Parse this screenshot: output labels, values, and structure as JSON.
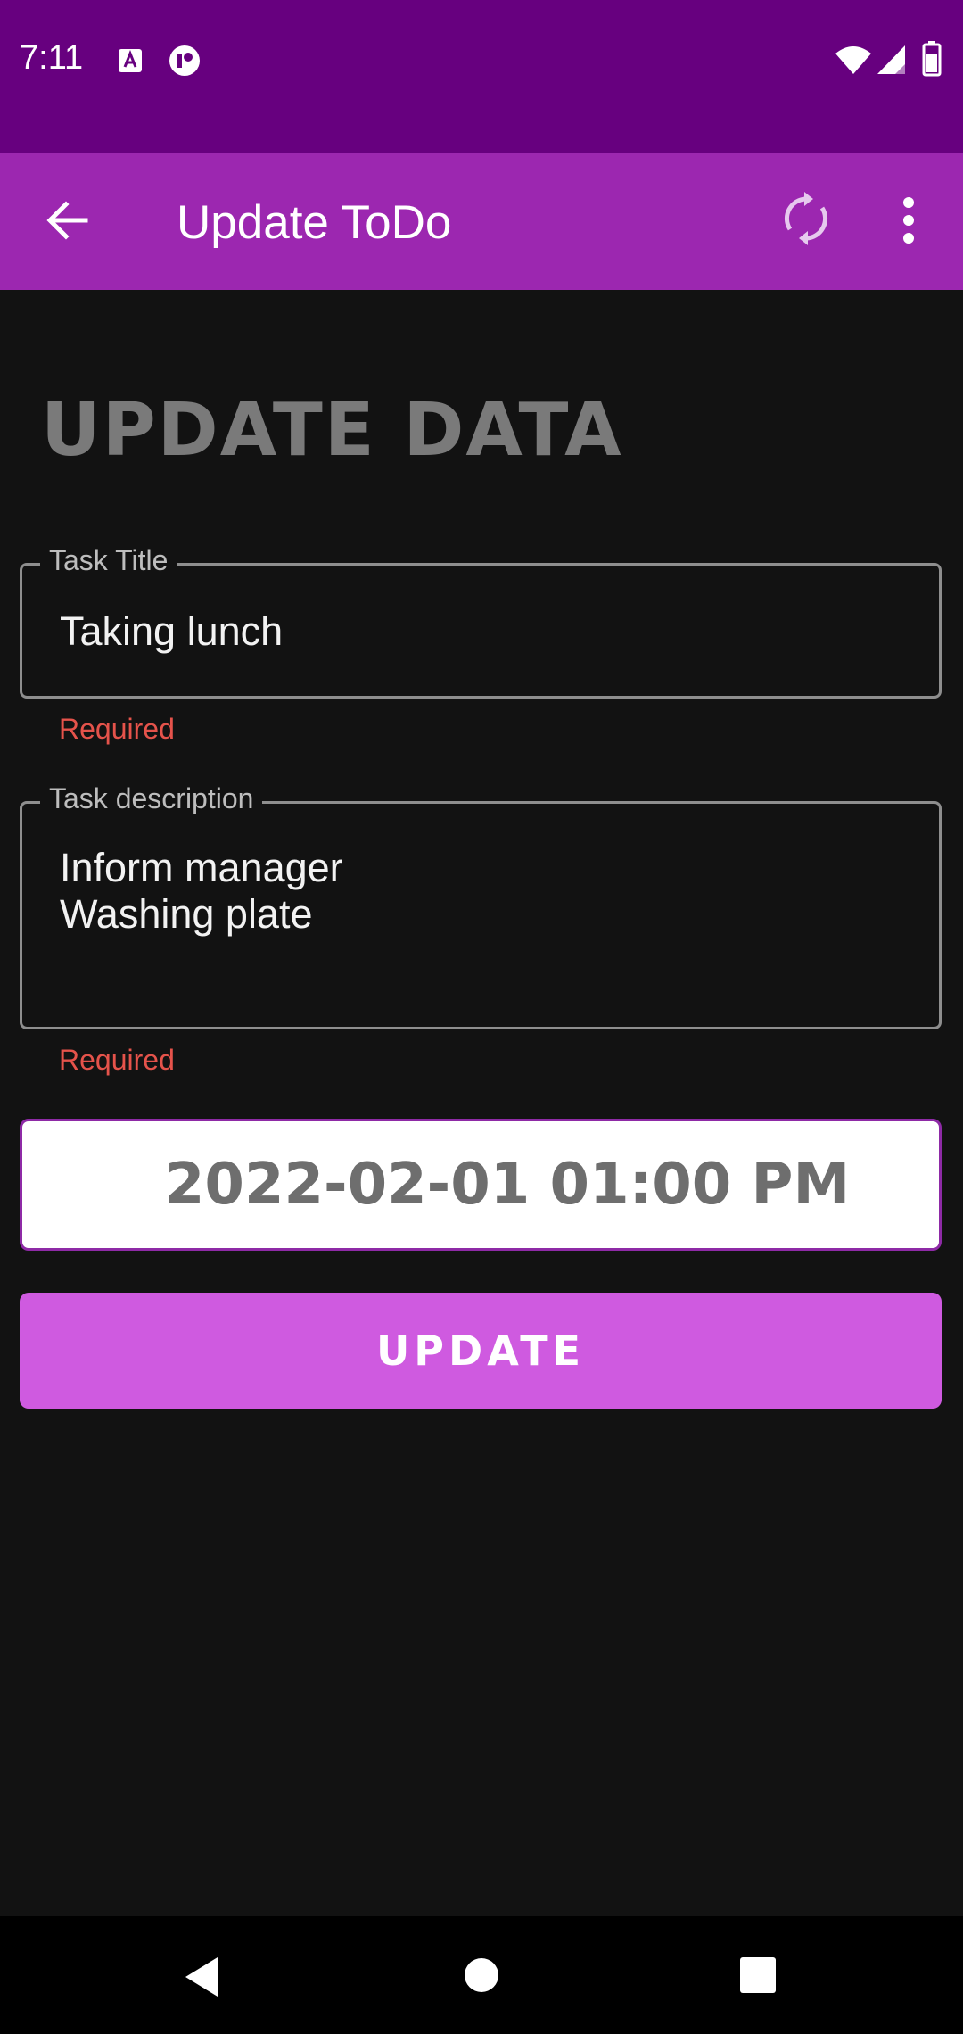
{
  "status_bar": {
    "time": "7:11",
    "icons": [
      "font-icon",
      "lock-record-icon",
      "wifi-icon",
      "signal-icon",
      "battery-icon"
    ]
  },
  "app_bar": {
    "title": "Update ToDo",
    "color": "#9c27b0",
    "icons": [
      "back-arrow-icon",
      "sync-icon",
      "more-vertical-icon"
    ]
  },
  "main": {
    "heading": "UPDATE DATA",
    "task_title": {
      "label": "Task Title",
      "value": "Taking lunch",
      "error": "Required"
    },
    "task_description": {
      "label": "Task description",
      "value": "Inform manager\nWashing plate",
      "error": "Required"
    },
    "date_time": "2022-02-01 01:00 PM",
    "update_button": "UPDATE",
    "accent_color": "#cf5ae0",
    "error_color": "#e5534b"
  },
  "nav_bar": {
    "icons": [
      "back-icon",
      "home-icon",
      "recents-icon"
    ]
  }
}
